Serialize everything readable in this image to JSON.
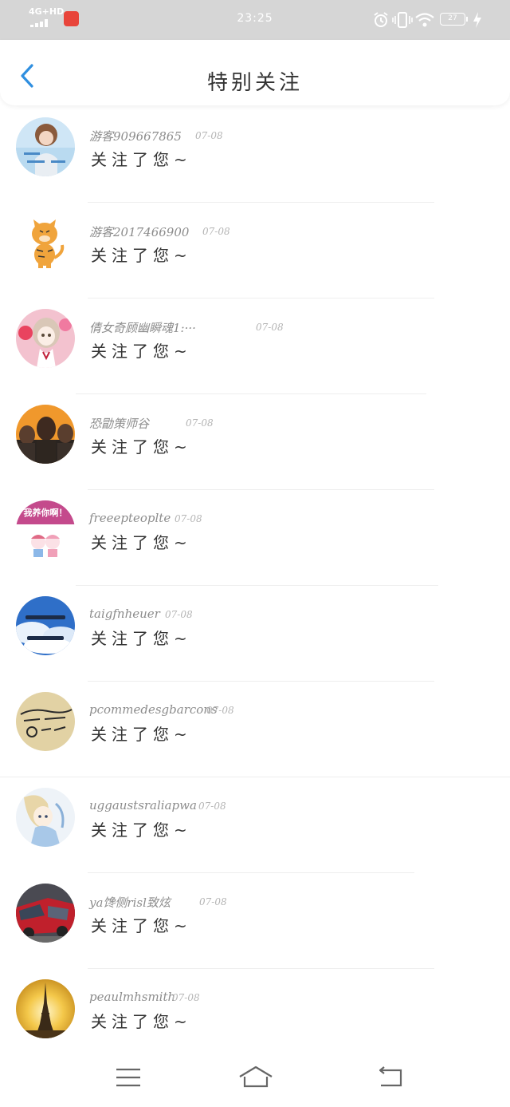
{
  "status_bar": {
    "network": "4G+HD",
    "time": "23:25",
    "battery": "27",
    "icons": [
      "signal-icon",
      "app-icon",
      "alarm-icon",
      "vibrate-icon",
      "wifi-icon",
      "battery-icon",
      "charging-icon"
    ]
  },
  "header": {
    "title": "特别关注",
    "back_icon": "chevron-left-icon"
  },
  "follows": [
    {
      "username": "游客909667865",
      "date": "07-08",
      "message": "关注了您~"
    },
    {
      "username": "游客2017466900",
      "date": "07-08",
      "message": "关注了您~"
    },
    {
      "username": "倩女奇顾幽瞬魂1:···",
      "date": "07-08",
      "message": "关注了您~"
    },
    {
      "username": "恐勖策师谷",
      "date": "07-08",
      "message": "关注了您~"
    },
    {
      "username": "freeepteoplte",
      "date": "07-08",
      "message": "关注了您~"
    },
    {
      "username": "taigfnheuer",
      "date": "07-08",
      "message": "关注了您~"
    },
    {
      "username": "pcommedesgbarcons",
      "date": "07-08",
      "message": "关注了您~"
    },
    {
      "username": "uggaustsraliapwa",
      "date": "07-08",
      "message": "关注了您~"
    },
    {
      "username": "ya馋侧risl致炫",
      "date": "07-08",
      "message": "关注了您~"
    },
    {
      "username": "peaulmhsmith",
      "date": "07-08",
      "message": "关注了您~"
    }
  ],
  "avatar_texts": {
    "a5": "我养你啊！"
  },
  "nav_bar": {
    "icons": [
      "menu-icon",
      "home-icon",
      "back-icon"
    ]
  },
  "colors": {
    "accent": "#2f8fe0",
    "status_bar_bg": "#d6d6d6",
    "username": "#8c8c8c",
    "date": "#b4b4b4",
    "message": "#333333"
  }
}
